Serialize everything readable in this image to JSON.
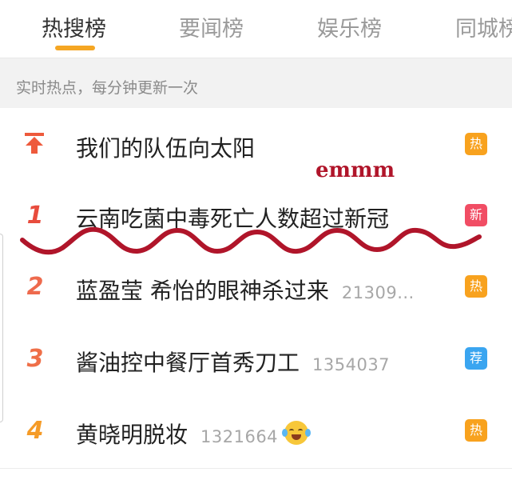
{
  "tabs": [
    {
      "label": "热搜榜",
      "active": true
    },
    {
      "label": "要闻榜",
      "active": false
    },
    {
      "label": "娱乐榜",
      "active": false
    },
    {
      "label": "同城榜",
      "active": false
    }
  ],
  "subheader": "实时热点，每分钟更新一次",
  "items": [
    {
      "rank": "",
      "title": "我们的队伍向太阳",
      "count": "",
      "badge": "热",
      "badge_type": "hot"
    },
    {
      "rank": "1",
      "title": "云南吃菌中毒死亡人数超过新冠",
      "count": "",
      "badge": "新",
      "badge_type": "new"
    },
    {
      "rank": "2",
      "title": "蓝盈莹 希怡的眼神杀过来",
      "count": "21309...",
      "badge": "热",
      "badge_type": "hot"
    },
    {
      "rank": "3",
      "title": "酱油控中餐厅首秀刀工",
      "count": "1354037",
      "badge": "荐",
      "badge_type": "rec"
    },
    {
      "rank": "4",
      "title": "黄晓明脱妆",
      "count": "1321664",
      "badge": "热",
      "badge_type": "hot"
    }
  ],
  "annotation": "emmm",
  "colors": {
    "accent_underline": "#f5a623",
    "badge_hot": "#f8a21e",
    "badge_new": "#f14d64",
    "badge_rec": "#3aa5f0",
    "scribble": "#b0152a"
  },
  "icons": {
    "pinned": "pin-top-arrow-icon",
    "emoji": "crying-laughing-emoji-icon"
  }
}
